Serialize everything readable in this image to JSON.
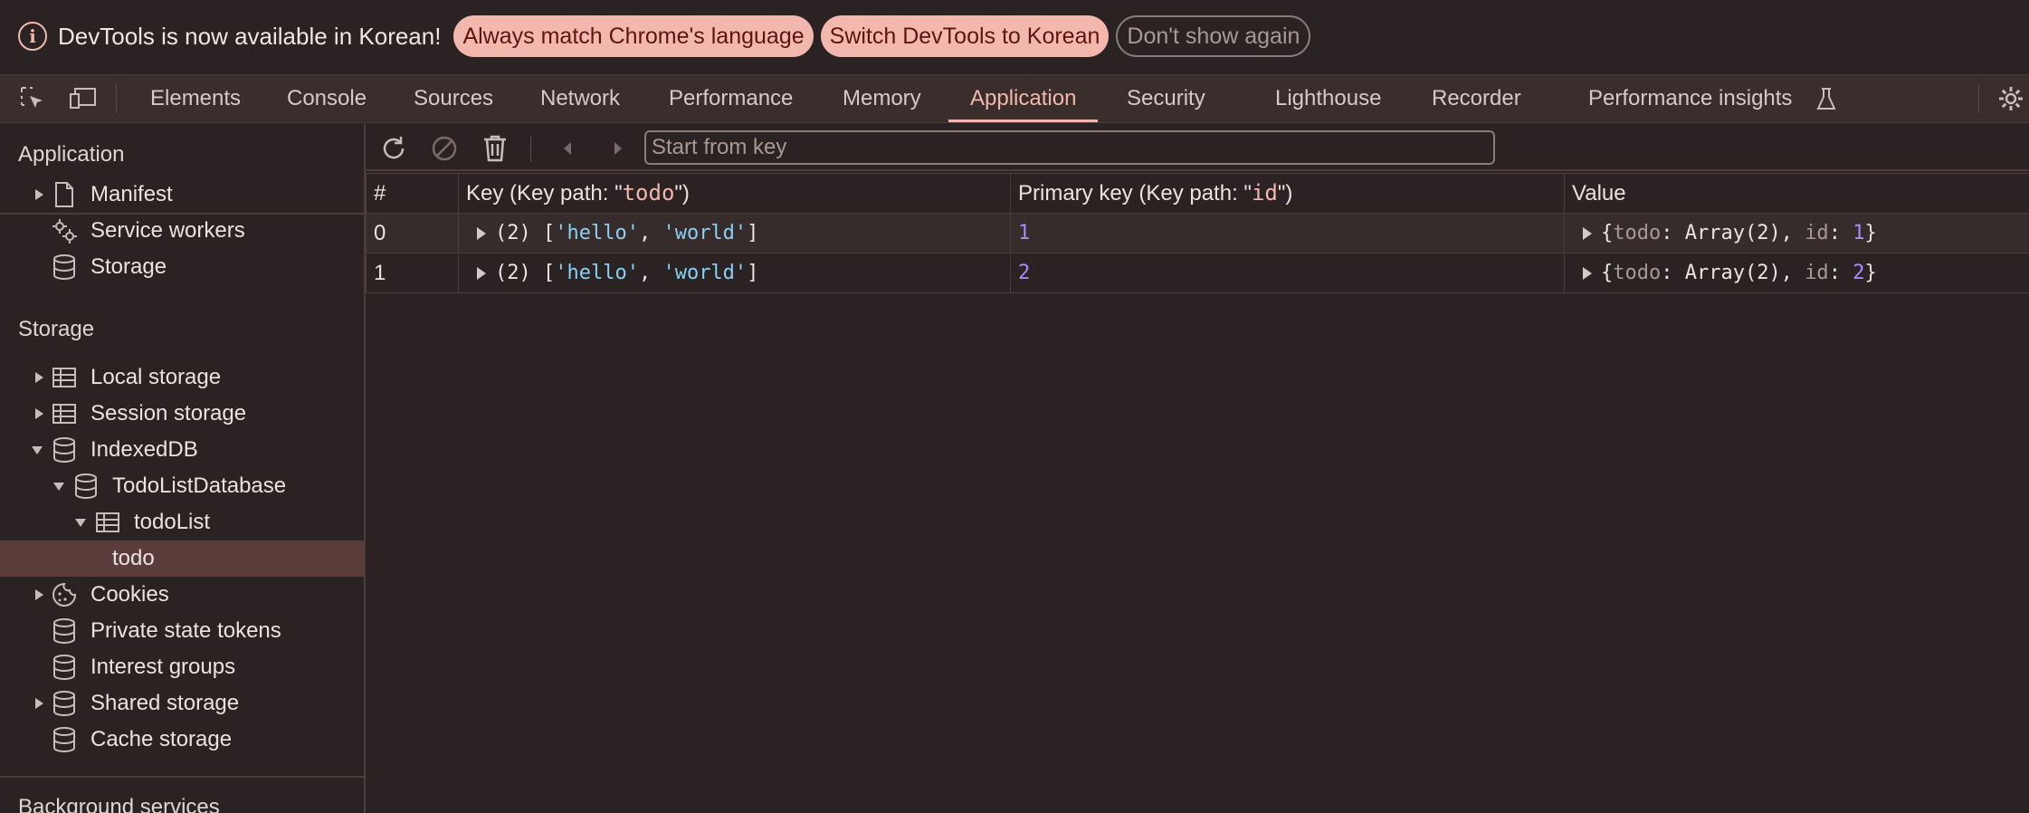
{
  "infobar": {
    "message": "DevTools is now available in Korean!",
    "btn_match": "Always match Chrome's language",
    "btn_switch": "Switch DevTools to Korean",
    "btn_dismiss": "Don't show again"
  },
  "tabs": {
    "elements": "Elements",
    "console": "Console",
    "sources": "Sources",
    "network": "Network",
    "performance": "Performance",
    "memory": "Memory",
    "application": "Application",
    "security": "Security",
    "lighthouse": "Lighthouse",
    "recorder": "Recorder",
    "perf_insights": "Performance insights",
    "active": "Application"
  },
  "sidebar": {
    "application_title": "Application",
    "application_items": [
      "Manifest",
      "Service workers",
      "Storage"
    ],
    "storage_title": "Storage",
    "storage_items": {
      "local": "Local storage",
      "session": "Session storage",
      "indexeddb": "IndexedDB",
      "database": "TodoListDatabase",
      "store": "todoList",
      "index": "todo",
      "cookies": "Cookies",
      "pst": "Private state tokens",
      "interest": "Interest groups",
      "shared": "Shared storage",
      "cache": "Cache storage"
    },
    "background_title": "Background services"
  },
  "toolbar": {
    "placeholder": "Start from key"
  },
  "table": {
    "headers": {
      "num": "#",
      "key_prefix": "Key (Key path: \"",
      "key_path": "todo",
      "key_suffix": "\")",
      "pk_prefix": "Primary key (Key path: \"",
      "pk_path": "id",
      "pk_suffix": "\")",
      "value": "Value"
    },
    "rows": [
      {
        "num": "0",
        "key_len": "(2) [",
        "key_a": "'hello'",
        "sep": ", ",
        "key_b": "'world'",
        "key_end": "]",
        "pk": "1",
        "val_open": "{",
        "val_prop1": "todo",
        "val_mid1": ": Array(2), ",
        "val_prop2": "id",
        "val_mid2": ": ",
        "val_id": "1",
        "val_close": "}"
      },
      {
        "num": "1",
        "key_len": "(2) [",
        "key_a": "'hello'",
        "sep": ", ",
        "key_b": "'world'",
        "key_end": "]",
        "pk": "2",
        "val_open": "{",
        "val_prop1": "todo",
        "val_mid1": ": Array(2), ",
        "val_prop2": "id",
        "val_mid2": ": ",
        "val_id": "2",
        "val_close": "}"
      }
    ]
  },
  "colors": {
    "accent": "#f2b8ad",
    "background": "#2b2323",
    "selected_row": "#5a3d3a",
    "string": "#8ad0f5",
    "number": "#a78bfa"
  }
}
